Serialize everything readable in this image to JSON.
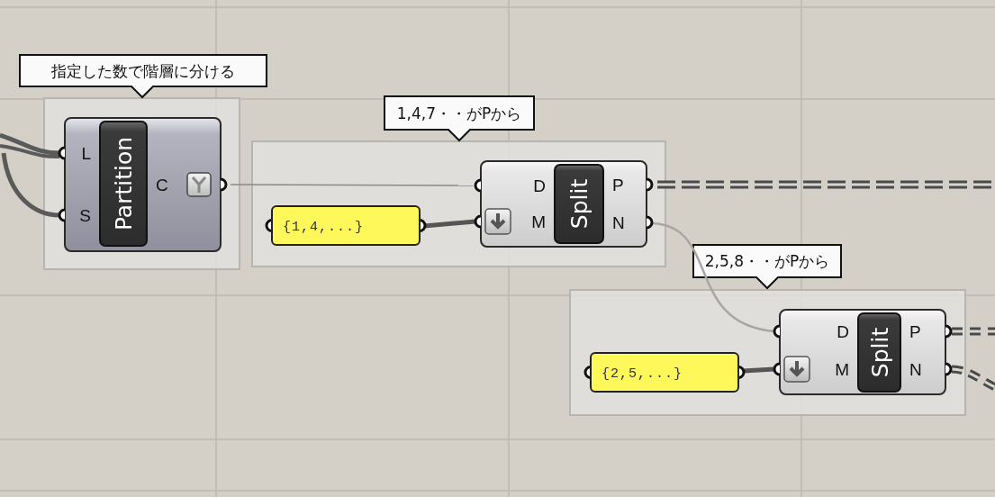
{
  "groups": [
    {
      "note": "指定した数で階層に分ける"
    },
    {
      "note": "1,4,7・・がPから"
    },
    {
      "note": "2,5,8・・がPから"
    }
  ],
  "components": [
    {
      "name": "Partition",
      "kind": "dark",
      "inputs": [
        {
          "label": "L",
          "flattened": false
        },
        {
          "label": "S",
          "flattened": false
        }
      ],
      "outputs": [
        {
          "label": "C",
          "grafted": true
        }
      ]
    },
    {
      "name": "Split",
      "kind": "light",
      "inputs": [
        {
          "label": "D",
          "flattened": false
        },
        {
          "label": "M",
          "flattened": true
        }
      ],
      "outputs": [
        {
          "label": "P",
          "grafted": false
        },
        {
          "label": "N",
          "grafted": false
        }
      ]
    },
    {
      "name": "Split",
      "kind": "light",
      "inputs": [
        {
          "label": "D",
          "flattened": false
        },
        {
          "label": "M",
          "flattened": true
        }
      ],
      "outputs": [
        {
          "label": "P",
          "grafted": false
        },
        {
          "label": "N",
          "grafted": false
        }
      ]
    }
  ],
  "panels": [
    {
      "value": "{1,4,...}"
    },
    {
      "value": "{2,5,...}"
    }
  ]
}
